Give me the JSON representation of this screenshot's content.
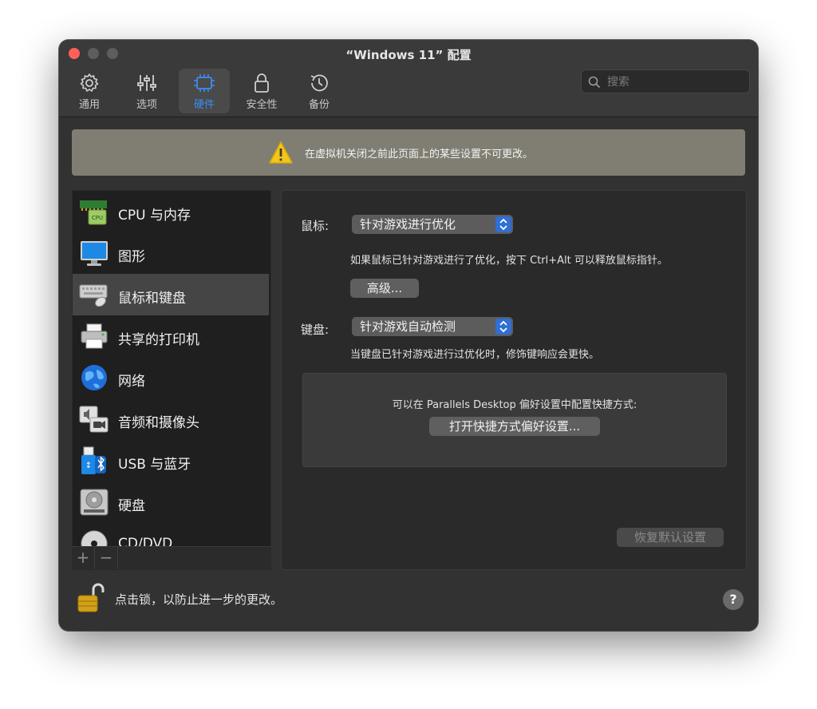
{
  "window": {
    "title": "“Windows 11” 配置"
  },
  "toolbar": {
    "items": [
      {
        "label": "通用",
        "icon": "gear-icon"
      },
      {
        "label": "选项",
        "icon": "sliders-icon"
      },
      {
        "label": "硬件",
        "icon": "chip-icon",
        "active": true
      },
      {
        "label": "安全性",
        "icon": "lock-icon"
      },
      {
        "label": "备份",
        "icon": "clock-history-icon"
      }
    ],
    "search_placeholder": "搜索"
  },
  "banner": {
    "text": "在虚拟机关闭之前此页面上的某些设置不可更改。",
    "icon": "warning-icon"
  },
  "sidebar": {
    "items": [
      {
        "label": "CPU 与内存",
        "icon": "cpu-memory-icon"
      },
      {
        "label": "图形",
        "icon": "monitor-icon"
      },
      {
        "label": "鼠标和键盘",
        "icon": "keyboard-mouse-icon",
        "selected": true
      },
      {
        "label": "共享的打印机",
        "icon": "printer-icon"
      },
      {
        "label": "网络",
        "icon": "globe-icon"
      },
      {
        "label": "音频和摄像头",
        "icon": "audio-camera-icon"
      },
      {
        "label": "USB 与蓝牙",
        "icon": "usb-bluetooth-icon"
      },
      {
        "label": "硬盘",
        "icon": "hard-disk-icon"
      },
      {
        "label": "CD/DVD",
        "icon": "cd-icon"
      }
    ],
    "add_label": "+",
    "remove_label": "−"
  },
  "content": {
    "mouse": {
      "label": "鼠标:",
      "value": "针对游戏进行优化",
      "description": "如果鼠标已针对游戏进行了优化，按下 Ctrl+Alt 可以释放鼠标指针。",
      "advanced_button": "高级..."
    },
    "keyboard": {
      "label": "键盘:",
      "value": "针对游戏自动检测",
      "description": "当键盘已针对游戏进行过优化时，修饰键响应会更快。"
    },
    "shortcuts": {
      "text": "可以在 Parallels Desktop 偏好设置中配置快捷方式:",
      "button": "打开快捷方式偏好设置..."
    },
    "restore_button": "恢复默认设置"
  },
  "footer": {
    "lock_text": "点击锁，以防止进一步的更改。",
    "help_label": "?"
  },
  "colors": {
    "accent": "#3b8cf5",
    "window_bg": "#323232",
    "banner_bg": "#807e73",
    "popup_arrow": "#2f6fd6"
  }
}
